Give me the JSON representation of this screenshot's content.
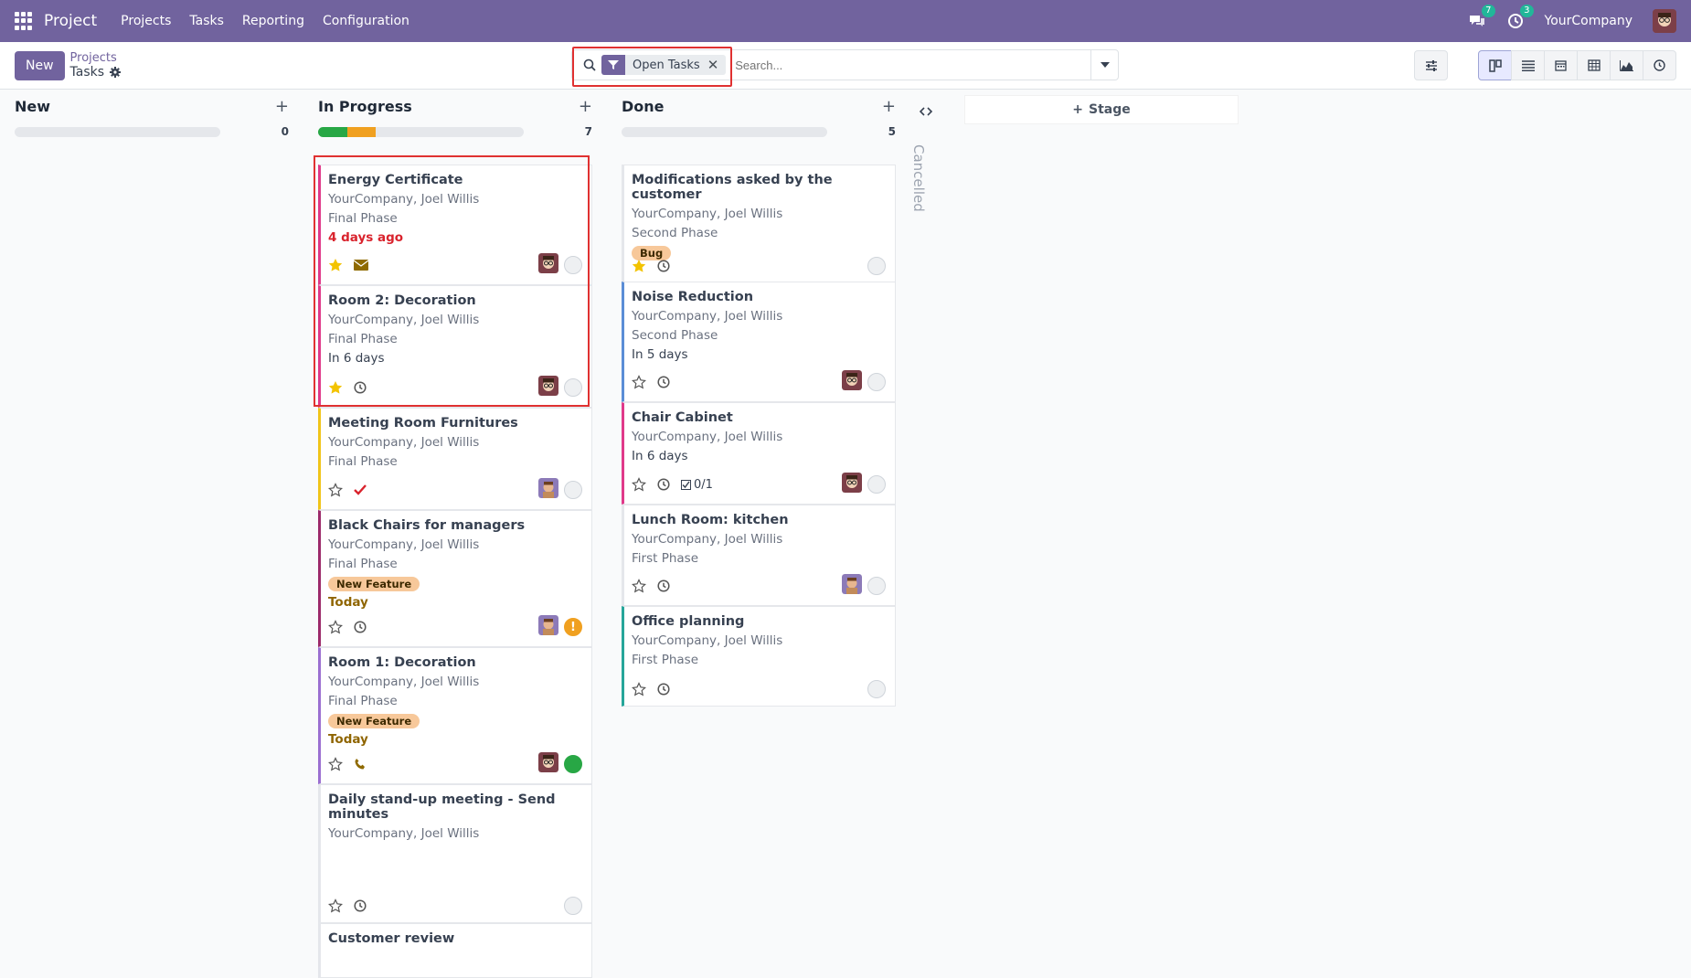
{
  "nav": {
    "app_name": "Project",
    "menu": [
      "Projects",
      "Tasks",
      "Reporting",
      "Configuration"
    ],
    "messages_count": "7",
    "activities_count": "3",
    "company": "YourCompany"
  },
  "control": {
    "new_label": "New",
    "breadcrumb_parent": "Projects",
    "breadcrumb_current": "Tasks",
    "facet_label": "Open Tasks",
    "facet_remove": "✕",
    "search_placeholder": "Search..."
  },
  "columns": {
    "new": {
      "title": "New",
      "count": "0",
      "progress": {
        "green": 0,
        "orange": 0
      }
    },
    "progress": {
      "title": "In Progress",
      "count": "7",
      "progress": {
        "green": 0.14,
        "orange": 0.14
      }
    },
    "done": {
      "title": "Done",
      "count": "5",
      "progress": {
        "green": 0,
        "orange": 0
      }
    },
    "cancelled": {
      "title": "Cancelled"
    }
  },
  "add_stage_label": "Stage",
  "cards_progress": [
    {
      "title": "Energy Certificate",
      "sub": "YourCompany, Joel Willis",
      "phase": "Final Phase",
      "date": "4 days ago",
      "date_color": "#d9232d",
      "starred": true,
      "activity": "envelope",
      "avatar": true,
      "state": "normal",
      "color": "#e03a8a"
    },
    {
      "title": "Room 2: Decoration",
      "sub": "YourCompany, Joel Willis",
      "phase": "Final Phase",
      "date": "In 6 days",
      "date_color": "#374151",
      "starred": true,
      "activity": "clock",
      "avatar": true,
      "state": "normal",
      "color": "#e03a8a"
    },
    {
      "title": "Meeting Room Furnitures",
      "sub": "YourCompany, Joel Willis",
      "phase": "Final Phase",
      "starred": false,
      "activity": "check",
      "avatar": true,
      "avatar2": true,
      "state": "normal",
      "color": "#f0c419"
    },
    {
      "title": "Black Chairs for managers",
      "sub": "YourCompany, Joel Willis",
      "phase": "Final Phase",
      "tag": "New Feature",
      "date": "Today",
      "date_color": "#8f6500",
      "starred": false,
      "activity": "clock",
      "avatar": true,
      "avatar2": true,
      "state": "warning",
      "color": "#9c2a6a"
    },
    {
      "title": "Room 1: Decoration",
      "sub": "YourCompany, Joel Willis",
      "phase": "Final Phase",
      "tag": "New Feature",
      "date": "Today",
      "date_color": "#8f6500",
      "starred": false,
      "activity": "phone",
      "avatar": true,
      "state": "done",
      "color": "#9b6fd1"
    },
    {
      "title": "Daily stand-up meeting - Send minutes",
      "sub": "YourCompany, Joel Willis",
      "starred": false,
      "activity": "clock",
      "avatar": false,
      "state": "normal",
      "color": "#e5e7eb"
    },
    {
      "title": "Customer review",
      "color": "#e5e7eb"
    }
  ],
  "cards_done": [
    {
      "title": "Modifications asked by the customer",
      "sub": "YourCompany, Joel Willis",
      "phase": "Second Phase",
      "tag": "Bug",
      "starred": true,
      "activity": "clock",
      "avatar": false,
      "state": "normal",
      "color": "#e5e7eb"
    },
    {
      "title": "Noise Reduction",
      "sub": "YourCompany, Joel Willis",
      "phase": "Second Phase",
      "date": "In 5 days",
      "date_color": "#374151",
      "starred": false,
      "activity": "clock",
      "avatar": true,
      "state": "normal",
      "color": "#5b8dd6"
    },
    {
      "title": "Chair Cabinet",
      "sub": "YourCompany, Joel Willis",
      "date": "In 6 days",
      "date_color": "#374151",
      "starred": false,
      "activity": "clock",
      "subtasks": "0/1",
      "avatar": true,
      "state": "normal",
      "color": "#e03a8a"
    },
    {
      "title": "Lunch Room: kitchen",
      "sub": "YourCompany, Joel Willis",
      "phase": "First Phase",
      "starred": false,
      "activity": "clock",
      "avatar": true,
      "avatar2": true,
      "state": "normal",
      "color": "#e5e7eb"
    },
    {
      "title": "Office planning",
      "sub": "YourCompany, Joel Willis",
      "phase": "First Phase",
      "starred": false,
      "activity": "clock",
      "avatar": false,
      "state": "normal",
      "color": "#26a69a"
    }
  ]
}
